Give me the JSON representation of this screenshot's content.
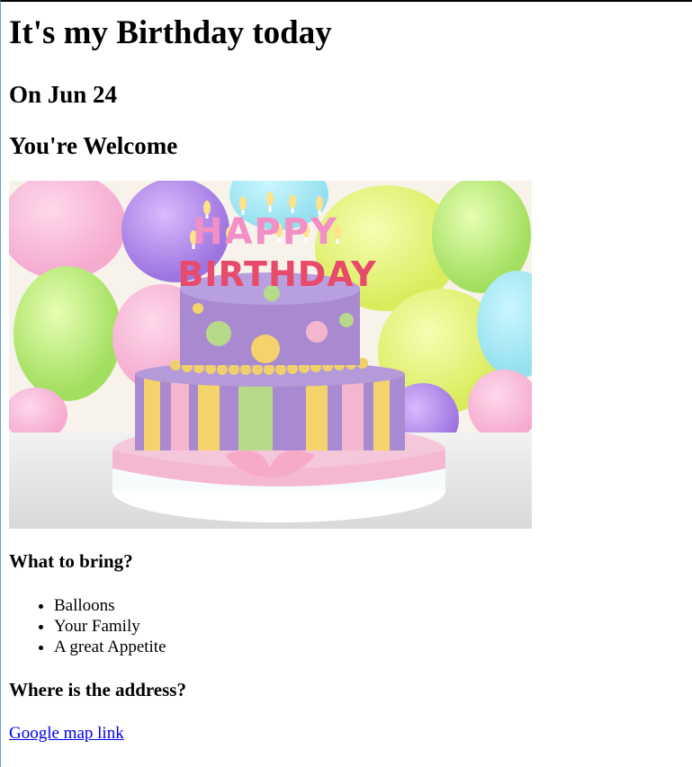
{
  "page": {
    "title": "It's my Birthday today",
    "date": "On Jun 24",
    "welcome": "You're Welcome"
  },
  "image": {
    "alt": "Birthday cake",
    "cake_text_top": "HAPPY",
    "cake_text_bottom": "BIRTHDAY",
    "colors": {
      "cake_purple": "#a98ad0",
      "ribbon_pink": "#f4b6cf",
      "accent_yellow": "#f3d36a",
      "accent_green": "#b7d98a"
    }
  },
  "bring": {
    "heading": "What to bring?",
    "items": [
      "Balloons",
      "Your Family",
      "A great Appetite"
    ]
  },
  "address": {
    "heading": "Where is the address?",
    "link_text": "Google map link"
  }
}
